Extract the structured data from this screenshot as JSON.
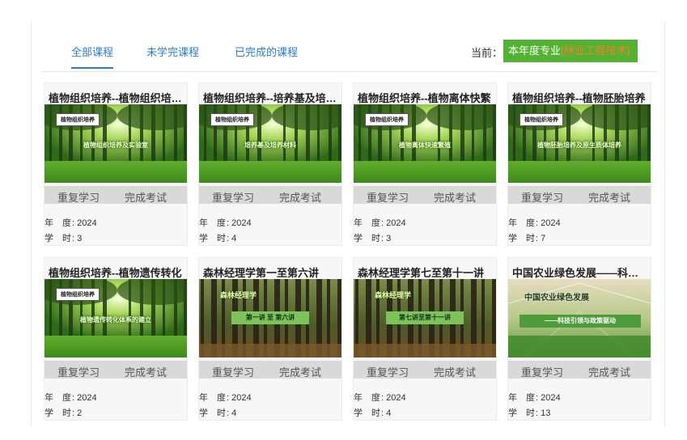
{
  "tabs": [
    "全部课程",
    "未学完课程",
    "已完成的课程"
  ],
  "current": {
    "label": "当前：",
    "prefix": "本年度专业",
    "major": "[林业工程技术]"
  },
  "meta_labels": {
    "year_a": "年",
    "year_b": "度",
    "hours_a": "学",
    "hours_b": "时"
  },
  "courses": [
    {
      "title": "植物组织培养--植物组织培养及实验室",
      "thumb_tag": "植物组织培养",
      "thumb_caption": "植物组织培养及实验室",
      "btn1": "重复学习",
      "btn2": "完成考试",
      "year": "2024",
      "hours": "3"
    },
    {
      "title": "植物组织培养--培养基及培养材料",
      "thumb_tag": "植物组织培养",
      "thumb_caption": "培养基及培养材料",
      "btn1": "重复学习",
      "btn2": "完成考试",
      "year": "2024",
      "hours": "4"
    },
    {
      "title": "植物组织培养--植物离体快繁",
      "thumb_tag": "植物组织培养",
      "thumb_caption": "植物离体快速繁殖",
      "btn1": "重复学习",
      "btn2": "完成考试",
      "year": "2024",
      "hours": "3"
    },
    {
      "title": "植物组织培养--植物胚胎培养",
      "thumb_tag": "植物组织培养",
      "thumb_caption": "植物胚胎培养及原生质体培养",
      "btn1": "重复学习",
      "btn2": "完成考试",
      "year": "2024",
      "hours": "7"
    },
    {
      "title": "植物组织培养--植物遗传转化",
      "thumb_tag": "植物组织培养",
      "thumb_caption": "植物遗传转化体系的建立",
      "btn1": "重复学习",
      "btn2": "完成考试",
      "year": "2024",
      "hours": "2"
    },
    {
      "title": "森林经理学第一至第六讲",
      "thumb_tag": "森林经理学",
      "thumb_caption": "第一讲 至 第六讲",
      "btn1": "重复学习",
      "btn2": "完成考试",
      "year": "2024",
      "hours": "4"
    },
    {
      "title": "森林经理学第七至第十一讲",
      "thumb_tag": "森林经理学",
      "thumb_caption": "第七讲至第十一讲",
      "btn1": "重复学习",
      "btn2": "完成考试",
      "year": "2024",
      "hours": "4"
    },
    {
      "title": "中国农业绿色发展——科技引领与政策驱动",
      "thumb_tag": "中国农业绿色发展",
      "thumb_caption": "——科技引领与政策驱动",
      "btn1": "重复学习",
      "btn2": "完成考试",
      "year": "2024",
      "hours": "13"
    }
  ]
}
